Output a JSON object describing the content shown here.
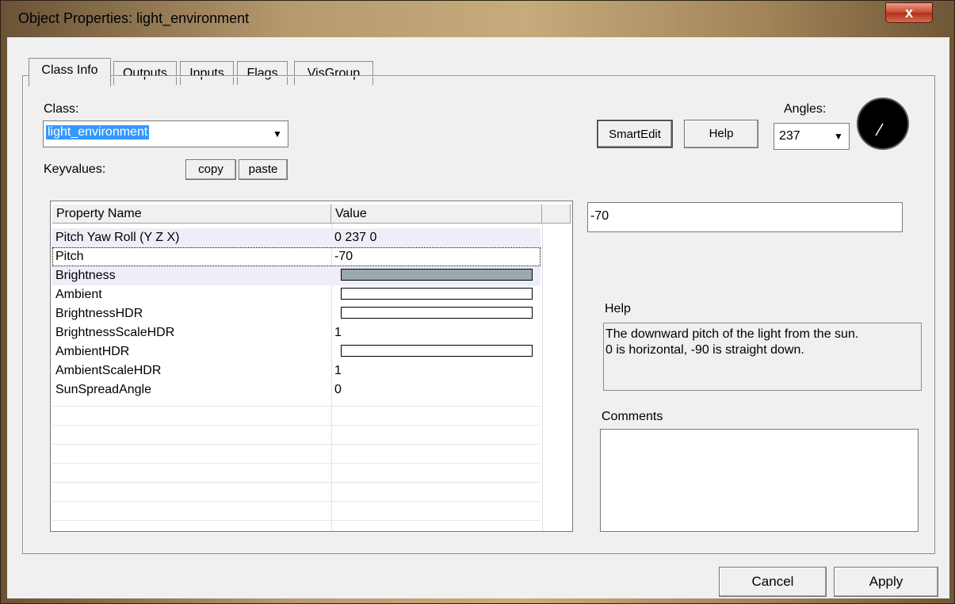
{
  "window": {
    "title": "Object Properties: light_environment",
    "close_label": "x"
  },
  "tabs": [
    {
      "label": "Class Info"
    },
    {
      "label": "Outputs"
    },
    {
      "label": "Inputs"
    },
    {
      "label": "Flags"
    },
    {
      "label": "VisGroup"
    }
  ],
  "class_section": {
    "class_label": "Class:",
    "class_value": "light_environment",
    "keyvalues_label": "Keyvalues:",
    "copy_label": "copy",
    "paste_label": "paste"
  },
  "toolbar": {
    "smartedit_label": "SmartEdit",
    "help_label": "Help",
    "angles_label": "Angles:",
    "angles_value": "237"
  },
  "grid": {
    "headers": [
      "Property Name",
      "Value"
    ],
    "rows": [
      {
        "name": "Pitch Yaw Roll (Y Z X)",
        "value": "0 237 0"
      },
      {
        "name": "Pitch",
        "value": "-70"
      },
      {
        "name": "Brightness",
        "value": ""
      },
      {
        "name": "Ambient",
        "value": ""
      },
      {
        "name": "BrightnessHDR",
        "value": ""
      },
      {
        "name": "BrightnessScaleHDR",
        "value": "1"
      },
      {
        "name": "AmbientHDR",
        "value": ""
      },
      {
        "name": "AmbientScaleHDR",
        "value": "1"
      },
      {
        "name": "SunSpreadAngle",
        "value": "0"
      }
    ]
  },
  "value_editor": {
    "value": "-70"
  },
  "help_panel": {
    "label": "Help",
    "text_line1": "The downward pitch of the light from the sun.",
    "text_line2": "0 is horizontal, -90 is straight down."
  },
  "comments": {
    "label": "Comments"
  },
  "footer": {
    "cancel_label": "Cancel",
    "apply_label": "Apply"
  },
  "colors": {
    "brightness_swatch": "#9aa9ad",
    "selection": "#3399ff"
  }
}
